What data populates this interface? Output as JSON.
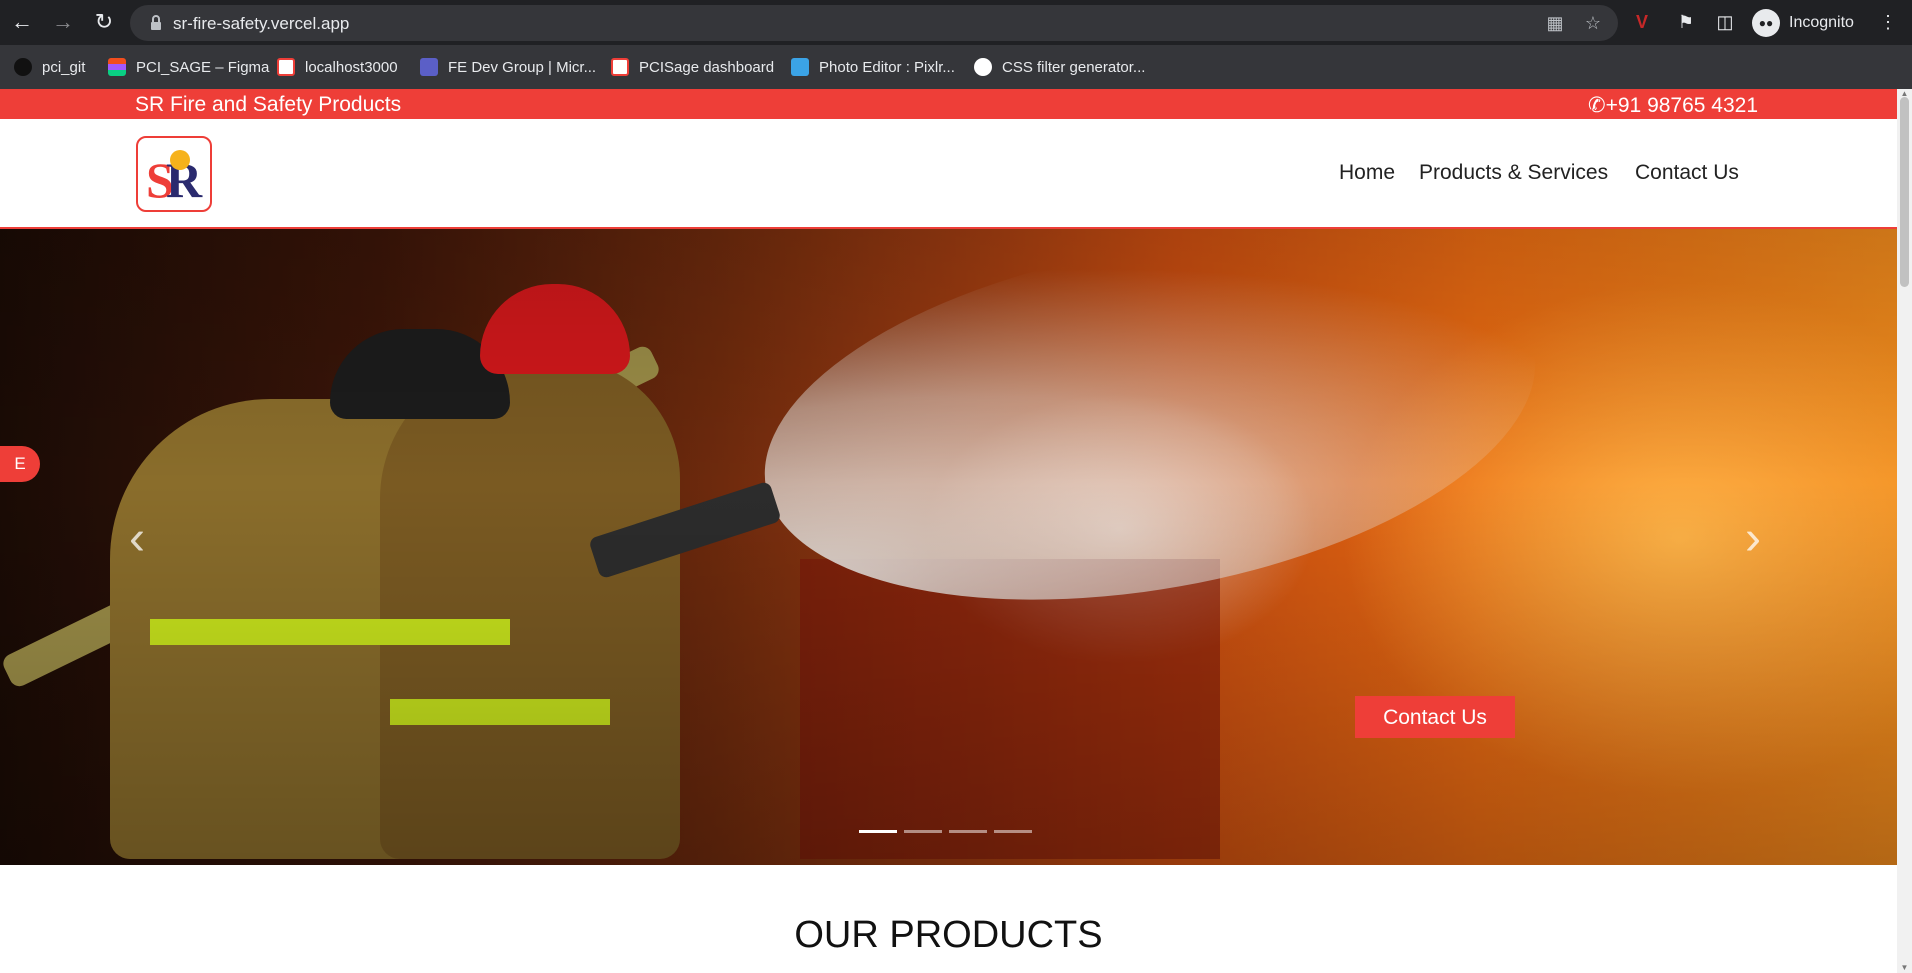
{
  "browser": {
    "url": "sr-fire-safety.vercel.app",
    "profile_label": "Incognito",
    "bookmarks": [
      {
        "label": "pci_git",
        "icon": "github-icon"
      },
      {
        "label": "PCI_SAGE – Figma",
        "icon": "figma-icon"
      },
      {
        "label": "localhost3000",
        "icon": "sr-logo-icon"
      },
      {
        "label": "FE Dev Group | Micr...",
        "icon": "teams-icon"
      },
      {
        "label": "PCISage dashboard",
        "icon": "sr-logo-icon"
      },
      {
        "label": "Photo Editor : Pixlr...",
        "icon": "pixlr-icon"
      },
      {
        "label": "CSS filter generator...",
        "icon": "css-filter-icon"
      }
    ]
  },
  "site": {
    "brand_name": "SR Fire and Safety Products",
    "phone": "+91 98765 4321",
    "logo_letters": {
      "s": "S",
      "r": "R"
    },
    "nav": [
      {
        "label": "Home"
      },
      {
        "label": "Products & Services"
      },
      {
        "label": "Contact Us"
      }
    ],
    "hero": {
      "cta_label": "Contact Us",
      "slide_count": 4,
      "active_slide": 1
    },
    "side_badge": "E",
    "products_heading": "OUR PRODUCTS"
  },
  "colors": {
    "accent": "#ee3e38",
    "browser_bg": "#202124",
    "bookmark_bar": "#35363a"
  }
}
